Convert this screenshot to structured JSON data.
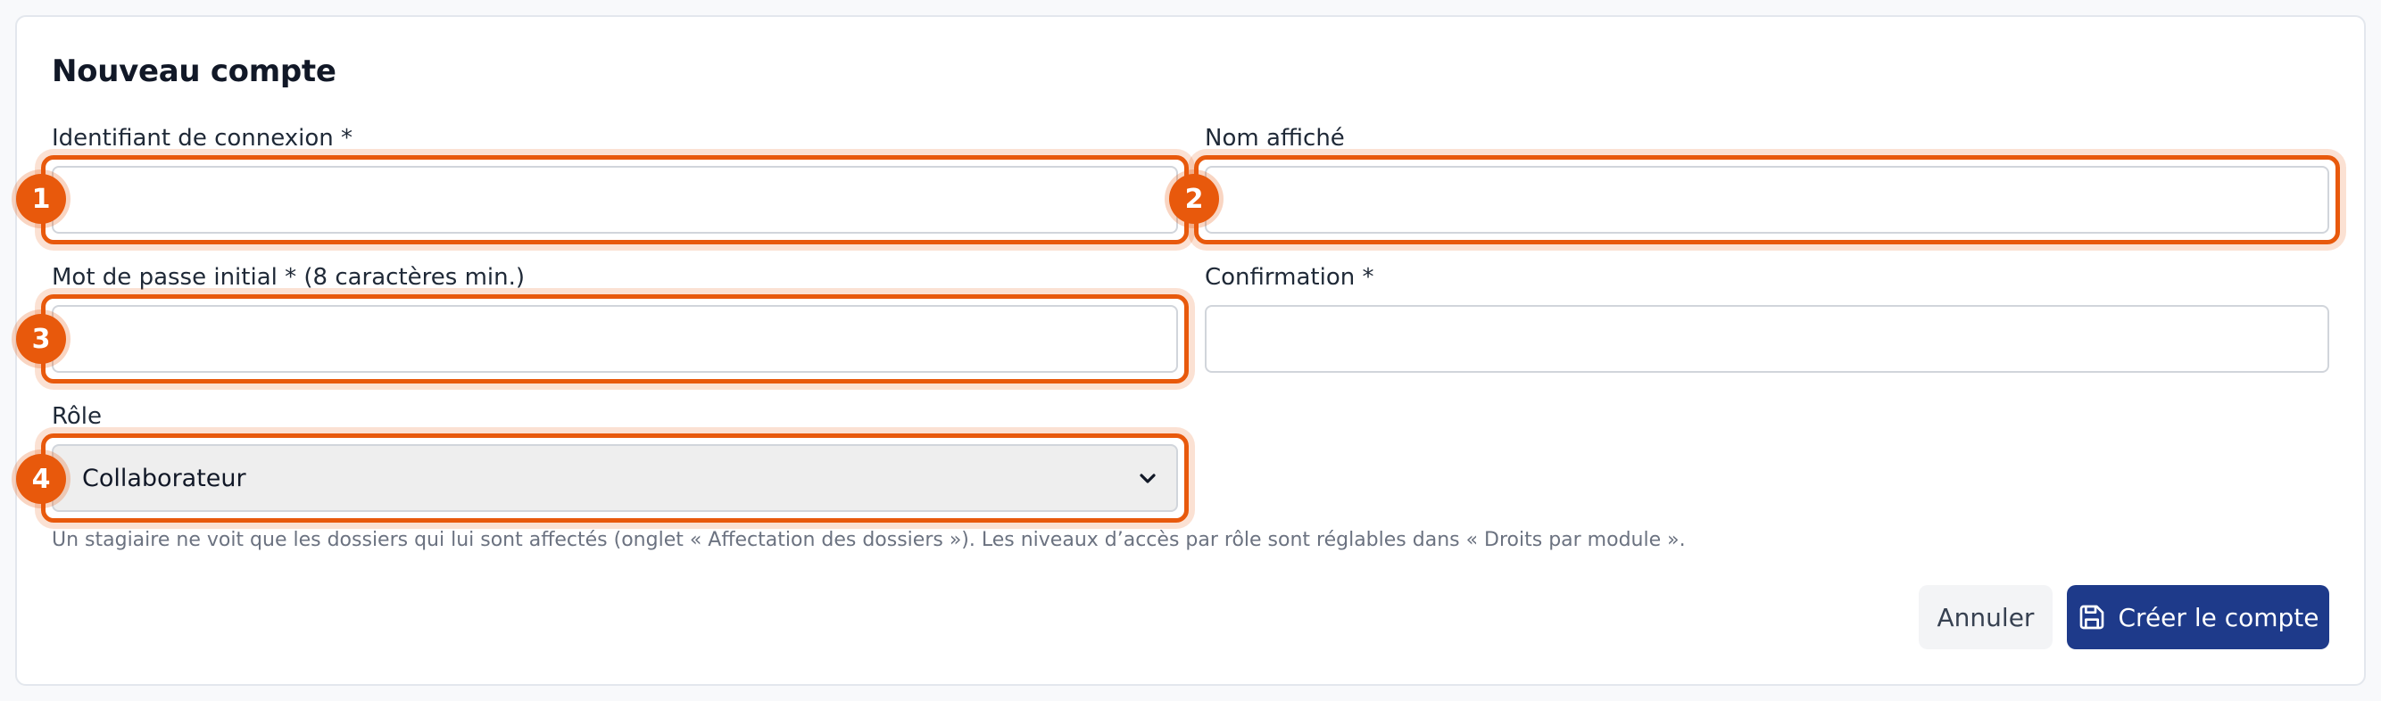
{
  "form": {
    "title": "Nouveau compte",
    "login_label": "Identifiant de connexion *",
    "display_name_label": "Nom affiché",
    "password_label": "Mot de passe initial * (8 caractères min.)",
    "confirmation_label": "Confirmation *",
    "role_label": "Rôle",
    "role_value": "Collaborateur",
    "help_text": "Un stagiaire ne voit que les dossiers qui lui sont affectés (onglet « Affectation des dossiers »). Les niveaux d’accès par rôle sont réglables dans « Droits par module ».",
    "login_value": "",
    "display_name_value": "",
    "password_value": "",
    "confirmation_value": ""
  },
  "annotations": {
    "marker_1": "1",
    "marker_2": "2",
    "marker_3": "3",
    "marker_4": "4",
    "accent_color": "#e8590c"
  },
  "actions": {
    "cancel_label": "Annuler",
    "create_label": "Créer le compte",
    "primary_color": "#1e3a8a"
  }
}
